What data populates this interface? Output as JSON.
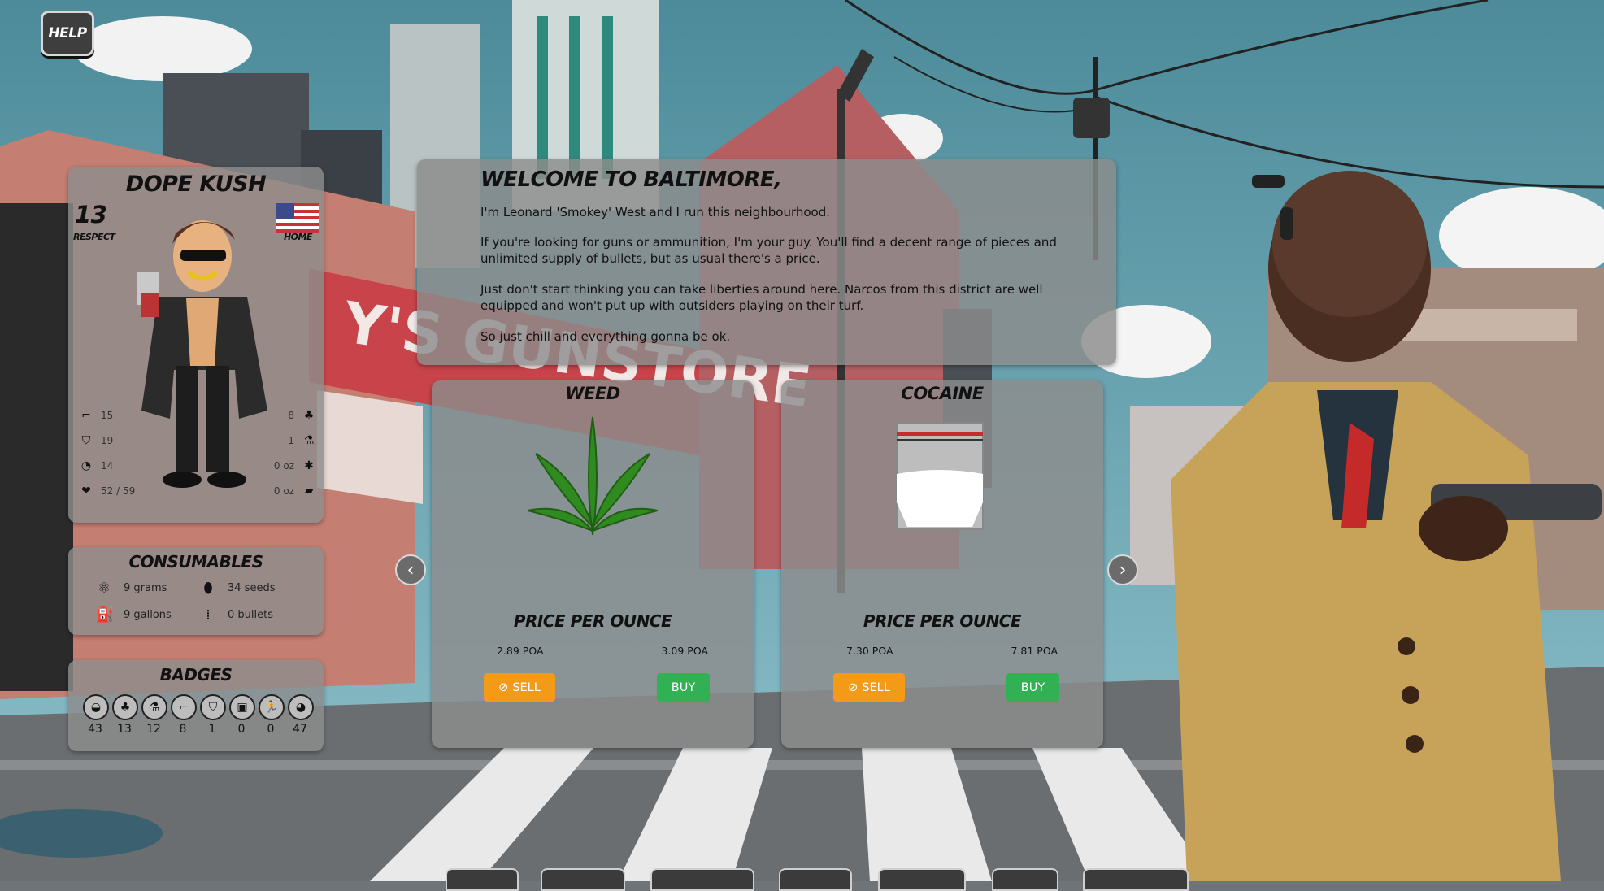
{
  "help_label": "HELP",
  "profile": {
    "name": "DOPE KUSH",
    "respect_value": "13",
    "respect_label": "RESPECT",
    "home_label": "HOME",
    "stats_left": [
      {
        "icon": "pistol-icon",
        "glyph": "⌐",
        "value": "15"
      },
      {
        "icon": "shield-icon",
        "glyph": "⛉",
        "value": "19"
      },
      {
        "icon": "speedometer-icon",
        "glyph": "◔",
        "value": "14"
      },
      {
        "icon": "health-icon",
        "glyph": "❤",
        "value": "52 / 59"
      }
    ],
    "stats_right": [
      {
        "icon": "plant-pot-icon",
        "glyph": "♣",
        "value": "8"
      },
      {
        "icon": "flask-icon",
        "glyph": "⚗",
        "value": "1"
      },
      {
        "icon": "weed-leaf-icon",
        "glyph": "✱",
        "value": "0 oz"
      },
      {
        "icon": "cocaine-bag-icon",
        "glyph": "▰",
        "value": "0 oz"
      }
    ]
  },
  "consumables": {
    "title": "CONSUMABLES",
    "items": [
      {
        "icon": "atom-icon",
        "glyph": "⚛",
        "value": "9 grams"
      },
      {
        "icon": "seed-icon",
        "glyph": "⬮",
        "value": "34 seeds"
      },
      {
        "icon": "gas-can-icon",
        "glyph": "⛽",
        "value": "9 gallons"
      },
      {
        "icon": "bullets-icon",
        "glyph": "⁞",
        "value": "0 bullets"
      }
    ]
  },
  "badges": {
    "title": "BADGES",
    "items": [
      {
        "icon": "seed-badge-icon",
        "glyph": "◒",
        "count": "43"
      },
      {
        "icon": "plant-badge-icon",
        "glyph": "♣",
        "count": "13"
      },
      {
        "icon": "lab-badge-icon",
        "glyph": "⚗",
        "count": "12"
      },
      {
        "icon": "gun-badge-icon",
        "glyph": "⌐",
        "count": "8"
      },
      {
        "icon": "shield-badge-icon",
        "glyph": "⛉",
        "count": "1"
      },
      {
        "icon": "safe-badge-icon",
        "glyph": "▣",
        "count": "0"
      },
      {
        "icon": "runner-badge-icon",
        "glyph": "🏃",
        "count": "0"
      },
      {
        "icon": "money-bag-badge-icon",
        "glyph": "◕",
        "count": "47"
      }
    ]
  },
  "welcome": {
    "title": "WELCOME TO BALTIMORE,",
    "paragraphs": [
      "I'm Leonard 'Smokey' West and I run this neighbourhood.",
      "If you're looking for guns or ammunition, I'm your guy. You'll find a decent range of pieces and unlimited supply of bullets, but as usual there's a price.",
      "Just don't start thinking you can take liberties around here. Narcos from this district are well equipped and won't put up with outsiders playing on their turf.",
      "So just chill and everything gonna be ok."
    ]
  },
  "markets": [
    {
      "title": "WEED",
      "price_label": "PRICE PER OUNCE",
      "sell_price": "2.89 POA",
      "buy_price": "3.09 POA",
      "sell_label": "SELL",
      "buy_label": "BUY"
    },
    {
      "title": "COCAINE",
      "price_label": "PRICE PER OUNCE",
      "sell_price": "7.30 POA",
      "buy_price": "7.81 POA",
      "sell_label": "SELL",
      "buy_label": "BUY"
    }
  ],
  "nav": {
    "prev": "‹",
    "next": "›"
  },
  "colors": {
    "sell": "#f39a18",
    "buy": "#31b054",
    "panel": "#8c8c8c"
  }
}
